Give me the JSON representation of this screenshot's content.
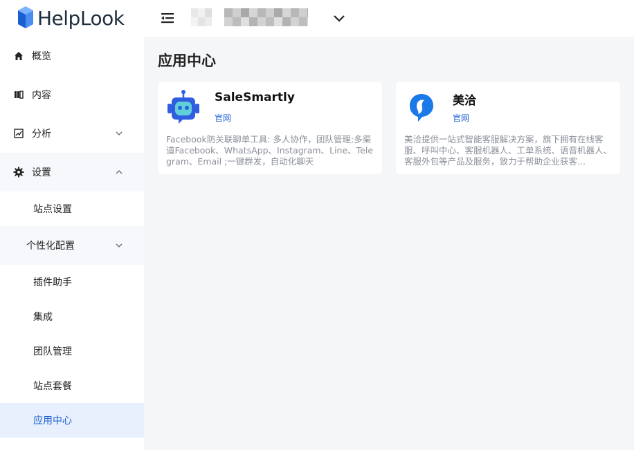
{
  "brand": {
    "name": "HelpLook",
    "accent": "#1a5fd1"
  },
  "sidebar": {
    "items": [
      {
        "label": "概览",
        "icon": "home-icon"
      },
      {
        "label": "内容",
        "icon": "book-icon"
      },
      {
        "label": "分析",
        "icon": "chart-icon"
      },
      {
        "label": "设置",
        "icon": "gear-icon"
      }
    ],
    "settings_children": [
      {
        "label": "站点设置"
      },
      {
        "label": "个性化配置"
      },
      {
        "label": "插件助手"
      },
      {
        "label": "集成"
      },
      {
        "label": "团队管理"
      },
      {
        "label": "站点套餐"
      },
      {
        "label": "应用中心"
      }
    ]
  },
  "topbar": {
    "menu_icon": "menu-collapse-icon",
    "dropdown_icon": "chevron-down-icon"
  },
  "main": {
    "title": "应用中心",
    "apps": [
      {
        "name": "SaleSmartly",
        "link": "官网",
        "description": "Facebook防关联聊单工具: 多人协作，团队管理;多渠道Facebook、WhatsApp、Instagram、Line、Telegram、Email ;一键群发，自动化聊天",
        "icon": "robot-icon"
      },
      {
        "name": "美洽",
        "link": "官网",
        "description": "美洽提供一站式智能客服解决方案，旗下拥有在线客服、呼叫中心、客服机器人、工单系统、语音机器人、客服外包等产品及服务，致力于帮助企业获客...",
        "icon": "chat-bird-icon"
      }
    ]
  }
}
